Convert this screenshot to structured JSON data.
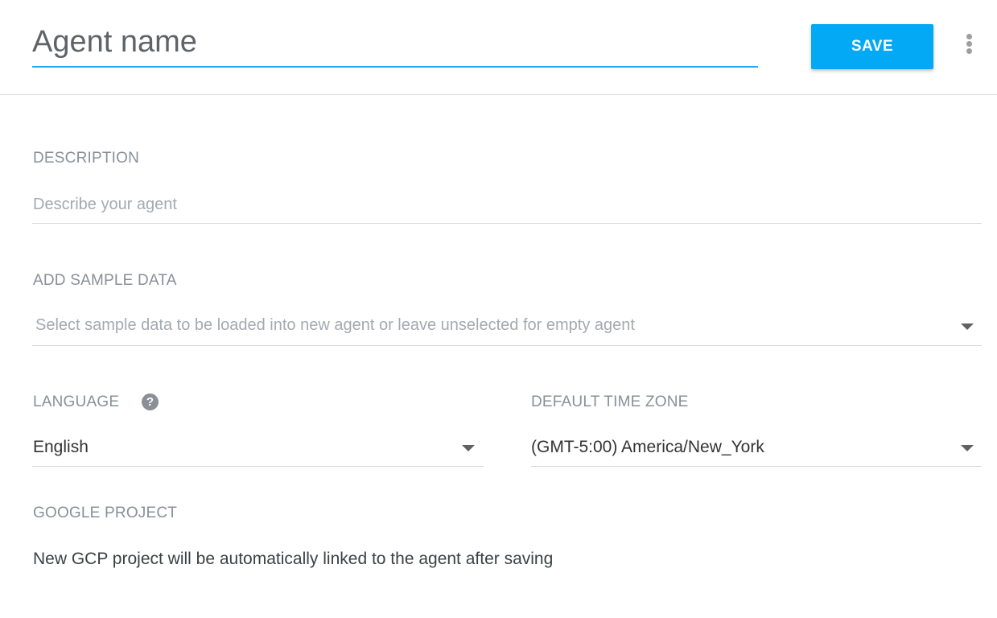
{
  "header": {
    "agent_name_placeholder": "Agent name",
    "save_label": "SAVE",
    "accent_color": "#2aa8f2",
    "save_color": "#03a9f4",
    "more_icon": "more-vertical-icon"
  },
  "description": {
    "label": "DESCRIPTION",
    "placeholder": "Describe your agent",
    "value": ""
  },
  "sample_data": {
    "label": "ADD SAMPLE DATA",
    "placeholder": "Select sample data to be loaded into new agent or leave unselected for empty agent",
    "dropdown_icon": "chevron-down-icon"
  },
  "language": {
    "label": "LANGUAGE",
    "help_icon": "help-icon",
    "help_glyph": "?",
    "selected": "English"
  },
  "time_zone": {
    "label": "DEFAULT TIME ZONE",
    "selected": "(GMT-5:00) America/New_York"
  },
  "google_project": {
    "label": "GOOGLE PROJECT",
    "text": "New GCP project will be automatically linked to the agent after saving"
  }
}
